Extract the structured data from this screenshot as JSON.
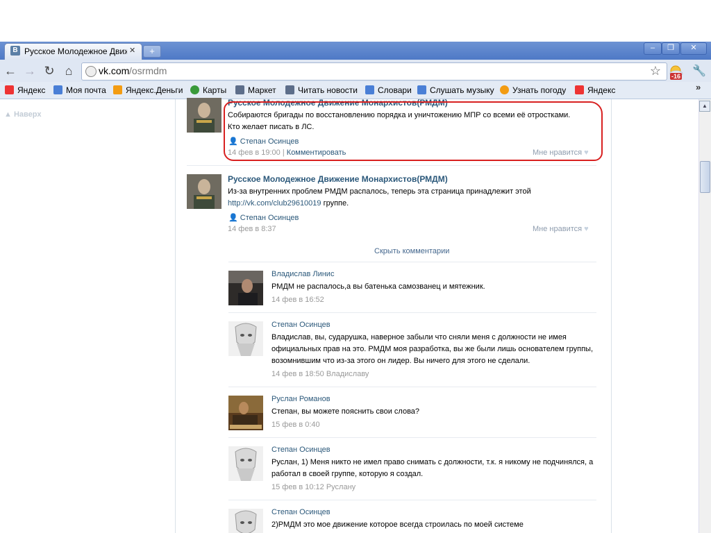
{
  "browser": {
    "tab_title": "Русское Молодежное Движе",
    "tab_favicon": "В",
    "url_domain": "vk.com",
    "url_path": "/osrmdm",
    "weather_temp": "-16"
  },
  "bookmarks": [
    {
      "label": "Яндекс",
      "icon": "yandex-icon",
      "color": "#e33"
    },
    {
      "label": "Моя почта",
      "icon": "mail-icon",
      "color": "#4a7fd6"
    },
    {
      "label": "Яндекс.Деньги",
      "icon": "money-icon",
      "color": "#f39c12"
    },
    {
      "label": "Карты",
      "icon": "map-icon",
      "color": "#3a9a3a"
    },
    {
      "label": "Маркет",
      "icon": "market-icon",
      "color": "#5d6e8a"
    },
    {
      "label": "Читать новости",
      "icon": "news-icon",
      "color": "#5d6e8a"
    },
    {
      "label": "Словари",
      "icon": "dictionary-icon",
      "color": "#4a7fd6"
    },
    {
      "label": "Слушать музыку",
      "icon": "music-icon",
      "color": "#4a7fd6"
    },
    {
      "label": "Узнать погоду",
      "icon": "weather-small-icon",
      "color": "#f39c12"
    },
    {
      "label": "Яндекс",
      "icon": "yandex-icon",
      "color": "#e33"
    }
  ],
  "page": {
    "scroll_up_label": "Наверх"
  },
  "posts": [
    {
      "title": "Русское Молодежное Движение Монархистов(РМДМ)",
      "text_line1": "Собираются бригады по восстановлению порядка и уничтожению МПР со всеми её отростками.",
      "text_line2": "Кто желает писать в ЛС.",
      "author": "Степан Осинцев",
      "date": "14 фев в 19:00",
      "separator": "|",
      "comment_label": "Комментировать",
      "like_label": "Мне нравится"
    },
    {
      "title": "Русское Молодежное Движение Монархистов(РМДМ)",
      "text_line1": "Из-за внутренних проблем РМДМ распалось, теперь эта страница принадлежит этой",
      "text_link": "http://vk.com/club29610019",
      "text_after_link": " группе.",
      "author": "Степан Осинцев",
      "date": "14 фев в 8:37",
      "like_label": "Мне нравится",
      "hide_comments": "Скрыть комментарии"
    }
  ],
  "comments": [
    {
      "name": "Владислав Линис",
      "lines": [
        "РМДМ не распалось,а вы батенька самозванец и мятежник."
      ],
      "meta": "14 фев в 16:52"
    },
    {
      "name": "Степан Осинцев",
      "lines": [
        "Владислав, вы, сударушка, наверное забыли что сняли меня с должности не имея",
        "официальных прав на это. РМДМ моя разработка, вы же были лишь основателем группы,",
        "возомнившим что из-за этого он лидер. Вы ничего для этого не сделали."
      ],
      "meta": "14 фев в 18:50 Владиславу"
    },
    {
      "name": "Руслан Романов",
      "lines": [
        "Степан, вы можете пояснить свои слова?"
      ],
      "meta": "15 фев в 0:40"
    },
    {
      "name": "Степан Осинцев",
      "lines": [
        "Руслан, 1) Меня никто не имел право снимать с должности, т.к. я никому не подчинялся, а",
        "работал в своей группе, которую я создал."
      ],
      "meta": "15 фев в 10:12 Руслану"
    },
    {
      "name": "Степан Осинцев",
      "lines": [
        "2)РМДМ это мое движение которое всегда строилась по моей системе"
      ],
      "meta": ""
    }
  ]
}
